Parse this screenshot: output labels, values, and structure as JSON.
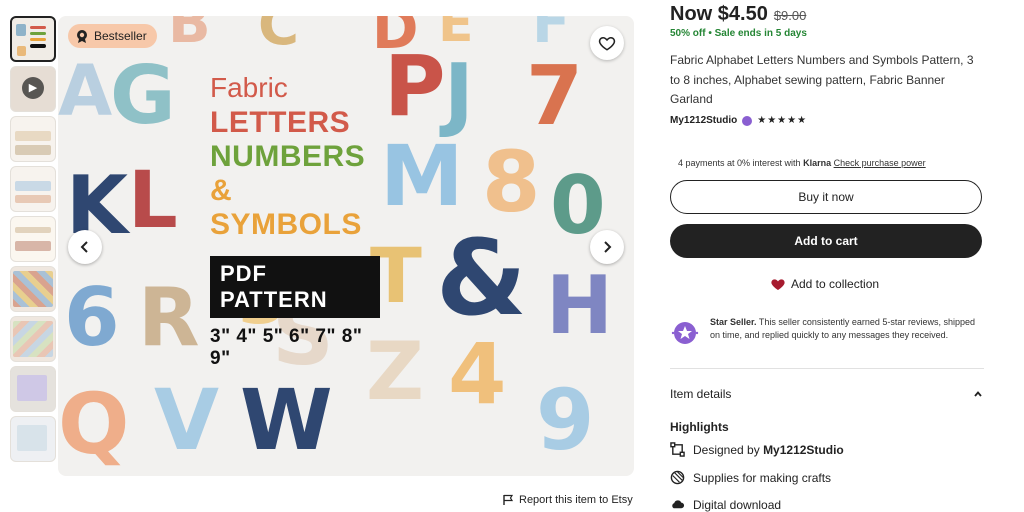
{
  "gallery": {
    "thumbnails": [
      {
        "name": "thumb-1",
        "active": true
      },
      {
        "name": "thumb-video",
        "video": true
      },
      {
        "name": "thumb-3"
      },
      {
        "name": "thumb-4"
      },
      {
        "name": "thumb-5"
      },
      {
        "name": "thumb-6"
      },
      {
        "name": "thumb-7"
      },
      {
        "name": "thumb-8"
      },
      {
        "name": "thumb-9"
      }
    ],
    "badge": "Bestseller",
    "hero": {
      "word_fabric": "Fabric",
      "word_letters": "LETTERS",
      "word_numbers": "NUMBERS",
      "word_symbols": "& SYMBOLS",
      "pdf_label": "PDF PATTERN",
      "sizes": "3\" 4\" 5\" 6\" 7\" 8\" 9\""
    },
    "report_label": "Report this item to Etsy"
  },
  "listing": {
    "price_now": "Now $4.50",
    "price_old": "$9.00",
    "discount": "50% off",
    "sale_ends": "Sale ends in 5 days",
    "title": "Fabric Alphabet Letters Numbers and Symbols Pattern, 3 to 8 inches, Alphabet sewing pattern, Fabric Banner Garland",
    "seller": "My1212Studio",
    "rating_stars": "★★★★★",
    "klarna_text": "4 payments at 0% interest with",
    "klarna_brand": "Klarna",
    "klarna_link": "Check purchase power",
    "buy_now": "Buy it now",
    "add_to_cart": "Add to cart",
    "add_to_collection": "Add to collection",
    "star_seller_title": "Star Seller.",
    "star_seller_text": "This seller consistently earned 5-star reviews, shipped on time, and replied quickly to any messages they received.",
    "item_details": "Item details",
    "highlights_title": "Highlights",
    "designed_by_label": "Designed by",
    "designed_by_name": "My1212Studio",
    "supplies": "Supplies for making crafts",
    "digital": "Digital download"
  },
  "colors": {
    "sale_green": "#258635",
    "accent_dark": "#222222",
    "heart_red": "#a61a2e",
    "star_seller_purple": "#8a5fd1",
    "badge_peach": "#f7c8a9"
  }
}
